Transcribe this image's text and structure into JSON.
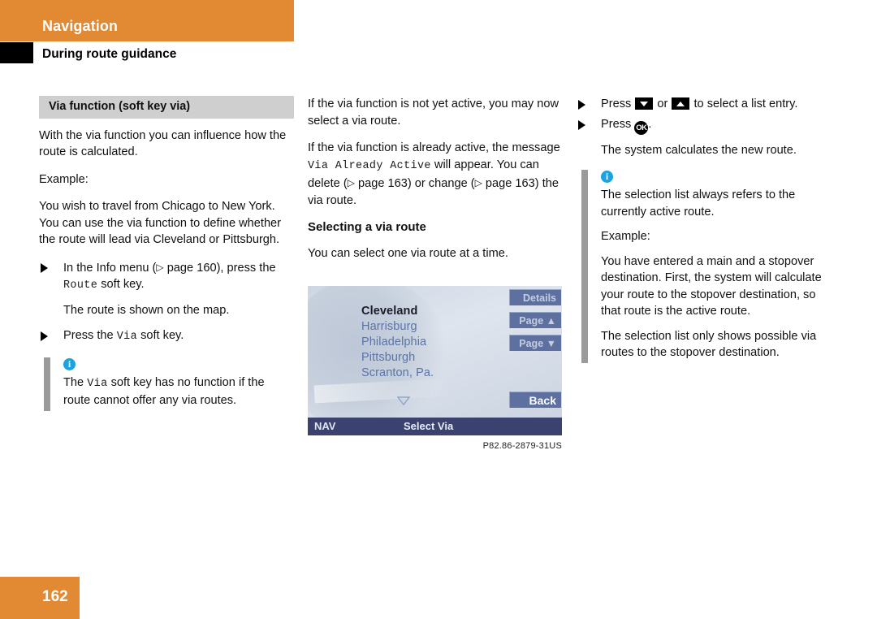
{
  "header": {
    "chapter_title": "Navigation",
    "section_title": "During route guidance",
    "accent_color": "#e28a33"
  },
  "column1": {
    "section_band": "Via function (soft key via)",
    "paragraph_1": "With the via function you can influence how the route is calculated.",
    "paragraph_2": "Example:",
    "paragraph_3": "You wish to travel from Chicago to New York. You can use the via function to define whether the route will lead via Cleveland or Pittsburgh.",
    "action_1_before": "In the Info menu (",
    "action_1_ref": "page 160",
    "action_1_mid": "), press the ",
    "action_1_key": "Route",
    "action_1_after": " soft key.",
    "action_1_result": "The route is shown on the map.",
    "action_2_before": "Press the ",
    "action_2_key": "Via",
    "action_2_after": " soft key.",
    "note_before": "The ",
    "note_key": "Via",
    "note_after": " soft key has no function if the route cannot offer any via routes."
  },
  "column2": {
    "paragraph_1": "If the via function is not yet active, you may now select a via route.",
    "paragraph_2_a": "If the via function is already active, the message ",
    "paragraph_2_key": "Via Already Active",
    "paragraph_2_b": " will appear. You can delete (",
    "paragraph_2_ref1": "page 163",
    "paragraph_2_c": ") or change (",
    "paragraph_2_ref2": "page 163",
    "paragraph_2_d": ") the via route.",
    "subheading": "Selecting a via route",
    "paragraph_3": "You can select one via route at a time.",
    "figure_caption": "P82.86-2879-31US"
  },
  "device": {
    "list_entries": [
      {
        "label": "Cleveland",
        "selected": true
      },
      {
        "label": "Harrisburg",
        "selected": false
      },
      {
        "label": "Philadelphia",
        "selected": false
      },
      {
        "label": "Pittsburgh",
        "selected": false
      },
      {
        "label": "Scranton, Pa.",
        "selected": false
      }
    ],
    "softkeys": {
      "details": "Details",
      "page_up": "Page ▲",
      "page_down": "Page ▼",
      "back": "Back"
    },
    "status_bar": {
      "mode": "NAV",
      "title": "Select Via"
    },
    "colors": {
      "softkey": "#5d70a0",
      "status_bar": "#3c4270",
      "entry": "#5a74a8"
    }
  },
  "column3": {
    "action_1_before": "Press ",
    "action_1_mid": " or ",
    "action_1_after": " to select a list entry.",
    "action_2_before": "Press ",
    "action_2_after": ".",
    "action_2_result": "The system calculates the new route.",
    "note_paragraph_1": "The selection list always refers to the currently active route.",
    "note_paragraph_2": "Example:",
    "note_paragraph_3": "You have entered a main and a stopover destination. First, the system will calculate your route to the stopover destination, so that route is the active route.",
    "note_paragraph_4": "The selection list only shows possible via routes to the stopover destination."
  },
  "footer": {
    "page_number": "162"
  }
}
